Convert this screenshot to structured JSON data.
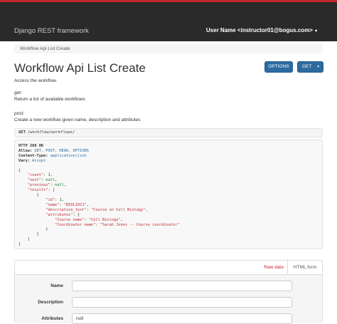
{
  "navbar": {
    "brand": "Django REST framework",
    "user": "User Name <instructor01@bogus.com>",
    "caret": "▾"
  },
  "breadcrumb": "Workflow Api List Create",
  "page": {
    "title": "Workflow Api List Create",
    "options_label": "OPTIONS",
    "get_label": "GET",
    "get_caret": "▾"
  },
  "description": {
    "access": "Access the workflow.",
    "get_heading": "get:",
    "get_text": "Return a list of available workflows",
    "post_heading": "post:",
    "post_text": "Create a new workflow given name, description and attributes"
  },
  "request": {
    "method": "GET",
    "path": "/workflow/workflows/"
  },
  "response": {
    "status": "HTTP 200 OK",
    "allow_label": "Allow:",
    "allow": "GET, POST, HEAD, OPTIONS",
    "content_type_label": "Content-Type:",
    "content_type": "application/json",
    "vary_label": "Vary:",
    "vary": "Accept",
    "body": {
      "count": "1",
      "next": "null",
      "previous": "null",
      "id": "1",
      "name": "\"BIOL1011\"",
      "description_text": "\"Course on Cell Biology\"",
      "course_name": "\"Cell Biology\"",
      "coordinator_name": "\"Sarah Jones -- Course coordinator\""
    }
  },
  "forms": {
    "tab_raw": "Raw data",
    "tab_html": "HTML form",
    "fields": [
      {
        "label": "Name",
        "value": ""
      },
      {
        "label": "Description",
        "value": ""
      },
      {
        "label": "Attributes",
        "value": "null"
      }
    ]
  },
  "colors": {
    "navbar_bg": "#2a2a2a",
    "navbar_accent": "#c1272d",
    "button_blue": "#2c6aa0",
    "string_red": "#c1272d",
    "number_green": "#007020"
  }
}
